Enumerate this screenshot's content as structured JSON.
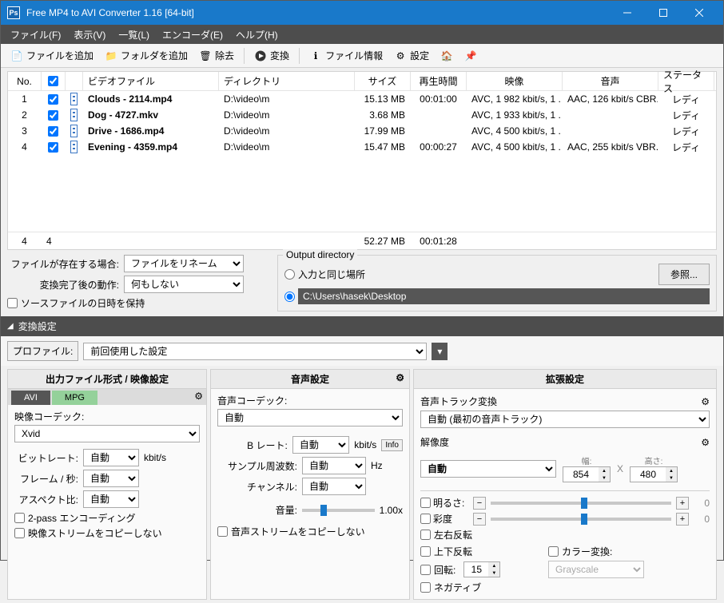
{
  "window": {
    "title": "Free MP4 to AVI Converter 1.16  [64-bit]"
  },
  "menu": {
    "file": "ファイル(F)",
    "view": "表示(V)",
    "list": "一覧(L)",
    "encoder": "エンコーダ(E)",
    "help": "ヘルプ(H)"
  },
  "toolbar": {
    "addfile": "ファイルを追加",
    "addfolder": "フォルダを追加",
    "remove": "除去",
    "convert": "変換",
    "fileinfo": "ファイル情報",
    "settings": "設定"
  },
  "columns": {
    "no": "No.",
    "video": "ビデオファイル",
    "dir": "ディレクトリ",
    "size": "サイズ",
    "duration": "再生時間",
    "vcodec": "映像",
    "acodec": "音声",
    "status": "ステータス"
  },
  "rows": [
    {
      "no": "1",
      "checked": true,
      "file": "Clouds - 2114.mp4",
      "dir": "D:\\video\\m",
      "size": "15.13 MB",
      "dur": "00:01:00",
      "vid": "AVC, 1 982 kbit/s, 1 ...",
      "aud": "AAC, 126 kbit/s CBR...",
      "status": "レディ"
    },
    {
      "no": "2",
      "checked": true,
      "file": "Dog - 4727.mkv",
      "dir": "D:\\video\\m",
      "size": "3.68 MB",
      "dur": "",
      "vid": "AVC, 1 933 kbit/s, 1 ...",
      "aud": "",
      "status": "レディ"
    },
    {
      "no": "3",
      "checked": true,
      "file": "Drive - 1686.mp4",
      "dir": "D:\\video\\m",
      "size": "17.99 MB",
      "dur": "",
      "vid": "AVC, 4 500 kbit/s, 1 ...",
      "aud": "",
      "status": "レディ"
    },
    {
      "no": "4",
      "checked": true,
      "file": "Evening - 4359.mp4",
      "dir": "D:\\video\\m",
      "size": "15.47 MB",
      "dur": "00:00:27",
      "vid": "AVC, 4 500 kbit/s, 1 ...",
      "aud": "AAC, 255 kbit/s VBR...",
      "status": "レディ"
    }
  ],
  "totals": {
    "count": "4",
    "checked": "4",
    "size": "52.27 MB",
    "dur": "00:01:28"
  },
  "mid": {
    "exists_label": "ファイルが存在する場合:",
    "exists_value": "ファイルをリネーム",
    "after_label": "変換完了後の動作:",
    "after_value": "何もしない",
    "preserve": "ソースファイルの日時を保持",
    "outdir_label": "Output directory",
    "same_loc": "入力と同じ場所",
    "custom_path": "C:\\Users\\hasek\\Desktop",
    "browse": "参照..."
  },
  "convset": {
    "header": "変換設定",
    "profile_label": "プロファイル:",
    "profile_value": "前回使用した設定"
  },
  "leftpanel": {
    "header": "出力ファイル形式 / 映像設定",
    "tabs": {
      "avi": "AVI",
      "mpg": "MPG"
    },
    "vcodec_label": "映像コーデック:",
    "vcodec_value": "Xvid",
    "bitrate_label": "ビットレート:",
    "bitrate_value": "自動",
    "bitrate_unit": "kbit/s",
    "fps_label": "フレーム / 秒:",
    "fps_value": "自動",
    "aspect_label": "アスペクト比:",
    "aspect_value": "自動",
    "twopass": "2-pass エンコーディング",
    "copyv": "映像ストリームをコピーしない"
  },
  "midpanel": {
    "header": "音声設定",
    "acodec_label": "音声コーデック:",
    "acodec_value": "自動",
    "brate_label": "B レート:",
    "brate_value": "自動",
    "brate_unit": "kbit/s",
    "info": "Info",
    "srate_label": "サンプル周波数:",
    "srate_value": "自動",
    "srate_unit": "Hz",
    "channel_label": "チャンネル:",
    "channel_value": "自動",
    "volume_label": "音量:",
    "volume_value": "1.00x",
    "copya": "音声ストリームをコピーしない"
  },
  "rightpanel": {
    "header": "拡張設定",
    "aconv_label": "音声トラック変換",
    "aconv_value": "自動 (最初の音声トラック)",
    "res_label": "解像度",
    "res_value": "自動",
    "w_label": "幅:",
    "w_value": "854",
    "h_label": "高さ:",
    "h_value": "480",
    "x": "X",
    "bright": "明るさ:",
    "bright_val": "0",
    "sat": "彩度",
    "sat_val": "0",
    "fliph": "左右反転",
    "flipv": "上下反転",
    "rotate": "回転:",
    "rotate_val": "15",
    "colorconv": "カラー変換:",
    "colorconv_val": "Grayscale",
    "negative": "ネガティブ"
  }
}
